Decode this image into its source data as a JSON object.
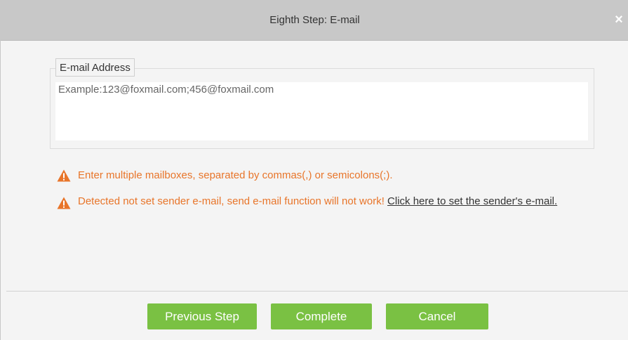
{
  "dialog": {
    "title": "Eighth Step: E-mail",
    "close_label": "×"
  },
  "email": {
    "legend": "E-mail Address",
    "value": "",
    "placeholder": "Example:123@foxmail.com;456@foxmail.com"
  },
  "warnings": [
    {
      "text": "Enter multiple mailboxes, separated by commas(,) or semicolons(;)."
    },
    {
      "text": "Detected not set sender e-mail, send e-mail function will not work! ",
      "link": "Click here to set the sender's e-mail."
    }
  ],
  "buttons": {
    "previous": "Previous Step",
    "complete": "Complete",
    "cancel": "Cancel"
  },
  "colors": {
    "accent": "#7ac143",
    "warning": "#e8752a",
    "titlebar": "#c8c8c8"
  },
  "icons": {
    "close": "close-icon",
    "warning": "warning-triangle-icon"
  }
}
